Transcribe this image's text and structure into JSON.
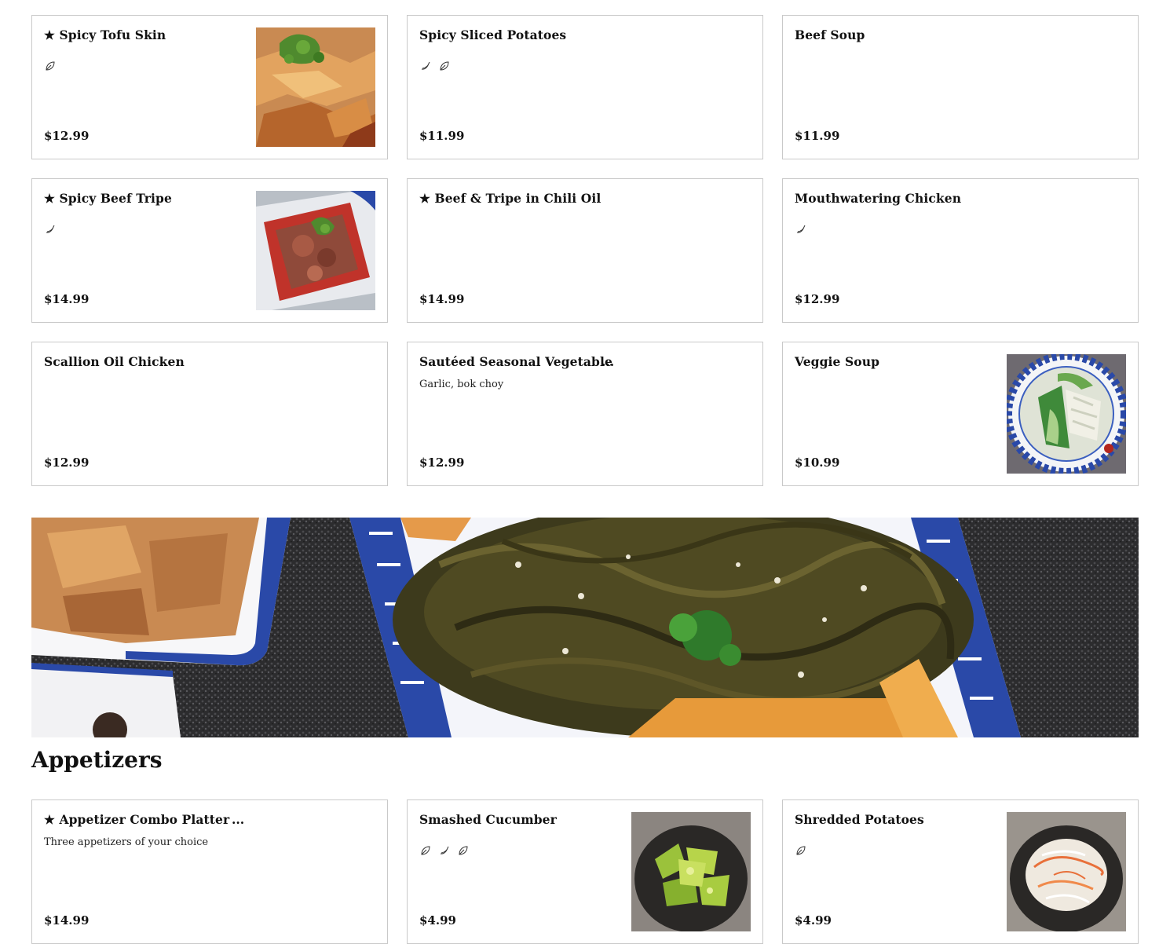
{
  "menu_rows": [
    [
      {
        "name": "★ Spicy Tofu Skin",
        "price": "$12.99",
        "icons": [
          "leaf-icon"
        ],
        "image": "tofu-skin"
      },
      {
        "name": "Spicy Sliced Potatoes",
        "price": "$11.99",
        "icons": [
          "chili-pepper-icon",
          "leaf-icon"
        ],
        "image": null
      },
      {
        "name": "Beef Soup",
        "price": "$11.99",
        "icons": [],
        "image": null
      }
    ],
    [
      {
        "name": "★ Spicy Beef Tripe",
        "price": "$14.99",
        "icons": [
          "chili-pepper-icon"
        ],
        "image": "beef-tripe"
      },
      {
        "name": "★ Beef & Tripe in Chili Oil",
        "price": "$14.99",
        "icons": [],
        "image": null
      },
      {
        "name": "Mouthwatering Chicken",
        "price": "$12.99",
        "icons": [
          "chili-pepper-icon"
        ],
        "image": null
      }
    ],
    [
      {
        "name": "Scallion Oil Chicken",
        "price": "$12.99",
        "icons": [],
        "image": null
      },
      {
        "name": "Sautéed Seasonal Vegetable",
        "more": "...",
        "description": "Garlic, bok choy",
        "price": "$12.99",
        "icons": [],
        "image": null
      },
      {
        "name": "Veggie Soup",
        "price": "$10.99",
        "icons": [],
        "image": "veggie-soup"
      }
    ]
  ],
  "section": {
    "title": "Appetizers"
  },
  "appetizers": [
    {
      "name": "★ Appetizer Combo Platter",
      "more": "...",
      "description": "Three appetizers of your choice",
      "price": "$14.99",
      "icons": [],
      "image": null
    },
    {
      "name": "Smashed Cucumber",
      "price": "$4.99",
      "icons": [
        "leaf-icon",
        "chili-pepper-icon",
        "leaf-icon"
      ],
      "image": "cucumber"
    },
    {
      "name": "Shredded Potatoes",
      "price": "$4.99",
      "icons": [
        "leaf-icon"
      ],
      "image": "shredded-potatoes"
    }
  ],
  "colors": {
    "card_border": "#c9c9c9",
    "text": "#111111",
    "plate_blue": "#2a49a8"
  }
}
